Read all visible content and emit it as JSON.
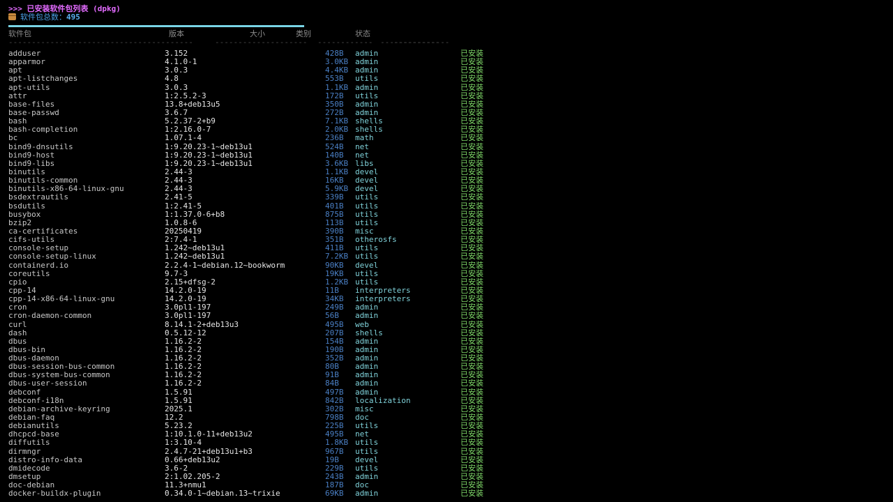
{
  "title": ">>> 已安装软件包列表 (dpkg)",
  "count_label": "软件包总数：",
  "count_value": "495",
  "progress_fraction": 1.0,
  "headers": {
    "name": "软件包",
    "version": "版本",
    "size": "大小",
    "category": "类别",
    "status": "状态"
  },
  "separators": {
    "name": "----------------------------------------",
    "version": "--------------------",
    "size": "------------",
    "category": "---------------",
    "status": "----------"
  },
  "packages": [
    {
      "name": "adduser",
      "version": "3.152",
      "size": "428B",
      "category": "admin",
      "status": "已安装"
    },
    {
      "name": "apparmor",
      "version": "4.1.0-1",
      "size": "3.0KB",
      "category": "admin",
      "status": "已安装"
    },
    {
      "name": "apt",
      "version": "3.0.3",
      "size": "4.4KB",
      "category": "admin",
      "status": "已安装"
    },
    {
      "name": "apt-listchanges",
      "version": "4.8",
      "size": "553B",
      "category": "utils",
      "status": "已安装"
    },
    {
      "name": "apt-utils",
      "version": "3.0.3",
      "size": "1.1KB",
      "category": "admin",
      "status": "已安装"
    },
    {
      "name": "attr",
      "version": "1:2.5.2-3",
      "size": "172B",
      "category": "utils",
      "status": "已安装"
    },
    {
      "name": "base-files",
      "version": "13.8+deb13u5",
      "size": "350B",
      "category": "admin",
      "status": "已安装"
    },
    {
      "name": "base-passwd",
      "version": "3.6.7",
      "size": "272B",
      "category": "admin",
      "status": "已安装"
    },
    {
      "name": "bash",
      "version": "5.2.37-2+b9",
      "size": "7.1KB",
      "category": "shells",
      "status": "已安装"
    },
    {
      "name": "bash-completion",
      "version": "1:2.16.0-7",
      "size": "2.0KB",
      "category": "shells",
      "status": "已安装"
    },
    {
      "name": "bc",
      "version": "1.07.1-4",
      "size": "236B",
      "category": "math",
      "status": "已安装"
    },
    {
      "name": "bind9-dnsutils",
      "version": "1:9.20.23-1~deb13u1",
      "size": "524B",
      "category": "net",
      "status": "已安装"
    },
    {
      "name": "bind9-host",
      "version": "1:9.20.23-1~deb13u1",
      "size": "140B",
      "category": "net",
      "status": "已安装"
    },
    {
      "name": "bind9-libs",
      "version": "1:9.20.23-1~deb13u1",
      "size": "3.6KB",
      "category": "libs",
      "status": "已安装"
    },
    {
      "name": "binutils",
      "version": "2.44-3",
      "size": "1.1KB",
      "category": "devel",
      "status": "已安装"
    },
    {
      "name": "binutils-common",
      "version": "2.44-3",
      "size": "16KB",
      "category": "devel",
      "status": "已安装"
    },
    {
      "name": "binutils-x86-64-linux-gnu",
      "version": "2.44-3",
      "size": "5.9KB",
      "category": "devel",
      "status": "已安装"
    },
    {
      "name": "bsdextrautils",
      "version": "2.41-5",
      "size": "339B",
      "category": "utils",
      "status": "已安装"
    },
    {
      "name": "bsdutils",
      "version": "1:2.41-5",
      "size": "401B",
      "category": "utils",
      "status": "已安装"
    },
    {
      "name": "busybox",
      "version": "1:1.37.0-6+b8",
      "size": "875B",
      "category": "utils",
      "status": "已安装"
    },
    {
      "name": "bzip2",
      "version": "1.0.8-6",
      "size": "113B",
      "category": "utils",
      "status": "已安装"
    },
    {
      "name": "ca-certificates",
      "version": "20250419",
      "size": "390B",
      "category": "misc",
      "status": "已安装"
    },
    {
      "name": "cifs-utils",
      "version": "2:7.4-1",
      "size": "351B",
      "category": "otherosfs",
      "status": "已安装"
    },
    {
      "name": "console-setup",
      "version": "1.242~deb13u1",
      "size": "411B",
      "category": "utils",
      "status": "已安装"
    },
    {
      "name": "console-setup-linux",
      "version": "1.242~deb13u1",
      "size": "7.2KB",
      "category": "utils",
      "status": "已安装"
    },
    {
      "name": "containerd.io",
      "version": "2.2.4-1~debian.12~bookworm",
      "size": "90KB",
      "category": "devel",
      "status": "已安装"
    },
    {
      "name": "coreutils",
      "version": "9.7-3",
      "size": "19KB",
      "category": "utils",
      "status": "已安装"
    },
    {
      "name": "cpio",
      "version": "2.15+dfsg-2",
      "size": "1.2KB",
      "category": "utils",
      "status": "已安装"
    },
    {
      "name": "cpp-14",
      "version": "14.2.0-19",
      "size": "11B",
      "category": "interpreters",
      "status": "已安装"
    },
    {
      "name": "cpp-14-x86-64-linux-gnu",
      "version": "14.2.0-19",
      "size": "34KB",
      "category": "interpreters",
      "status": "已安装"
    },
    {
      "name": "cron",
      "version": "3.0pl1-197",
      "size": "249B",
      "category": "admin",
      "status": "已安装"
    },
    {
      "name": "cron-daemon-common",
      "version": "3.0pl1-197",
      "size": "56B",
      "category": "admin",
      "status": "已安装"
    },
    {
      "name": "curl",
      "version": "8.14.1-2+deb13u3",
      "size": "495B",
      "category": "web",
      "status": "已安装"
    },
    {
      "name": "dash",
      "version": "0.5.12-12",
      "size": "207B",
      "category": "shells",
      "status": "已安装"
    },
    {
      "name": "dbus",
      "version": "1.16.2-2",
      "size": "154B",
      "category": "admin",
      "status": "已安装"
    },
    {
      "name": "dbus-bin",
      "version": "1.16.2-2",
      "size": "190B",
      "category": "admin",
      "status": "已安装"
    },
    {
      "name": "dbus-daemon",
      "version": "1.16.2-2",
      "size": "352B",
      "category": "admin",
      "status": "已安装"
    },
    {
      "name": "dbus-session-bus-common",
      "version": "1.16.2-2",
      "size": "80B",
      "category": "admin",
      "status": "已安装"
    },
    {
      "name": "dbus-system-bus-common",
      "version": "1.16.2-2",
      "size": "91B",
      "category": "admin",
      "status": "已安装"
    },
    {
      "name": "dbus-user-session",
      "version": "1.16.2-2",
      "size": "84B",
      "category": "admin",
      "status": "已安装"
    },
    {
      "name": "debconf",
      "version": "1.5.91",
      "size": "497B",
      "category": "admin",
      "status": "已安装"
    },
    {
      "name": "debconf-i18n",
      "version": "1.5.91",
      "size": "842B",
      "category": "localization",
      "status": "已安装"
    },
    {
      "name": "debian-archive-keyring",
      "version": "2025.1",
      "size": "302B",
      "category": "misc",
      "status": "已安装"
    },
    {
      "name": "debian-faq",
      "version": "12.2",
      "size": "798B",
      "category": "doc",
      "status": "已安装"
    },
    {
      "name": "debianutils",
      "version": "5.23.2",
      "size": "225B",
      "category": "utils",
      "status": "已安装"
    },
    {
      "name": "dhcpcd-base",
      "version": "1:10.1.0-11+deb13u2",
      "size": "495B",
      "category": "net",
      "status": "已安装"
    },
    {
      "name": "diffutils",
      "version": "1:3.10-4",
      "size": "1.8KB",
      "category": "utils",
      "status": "已安装"
    },
    {
      "name": "dirmngr",
      "version": "2.4.7-21+deb13u1+b3",
      "size": "967B",
      "category": "utils",
      "status": "已安装"
    },
    {
      "name": "distro-info-data",
      "version": "0.66+deb13u2",
      "size": "19B",
      "category": "devel",
      "status": "已安装"
    },
    {
      "name": "dmidecode",
      "version": "3.6-2",
      "size": "229B",
      "category": "utils",
      "status": "已安装"
    },
    {
      "name": "dmsetup",
      "version": "2:1.02.205-2",
      "size": "243B",
      "category": "admin",
      "status": "已安装"
    },
    {
      "name": "doc-debian",
      "version": "11.3+nmu1",
      "size": "187B",
      "category": "doc",
      "status": "已安装"
    },
    {
      "name": "docker-buildx-plugin",
      "version": "0.34.0-1~debian.13~trixie",
      "size": "69KB",
      "category": "admin",
      "status": "已安装"
    }
  ]
}
